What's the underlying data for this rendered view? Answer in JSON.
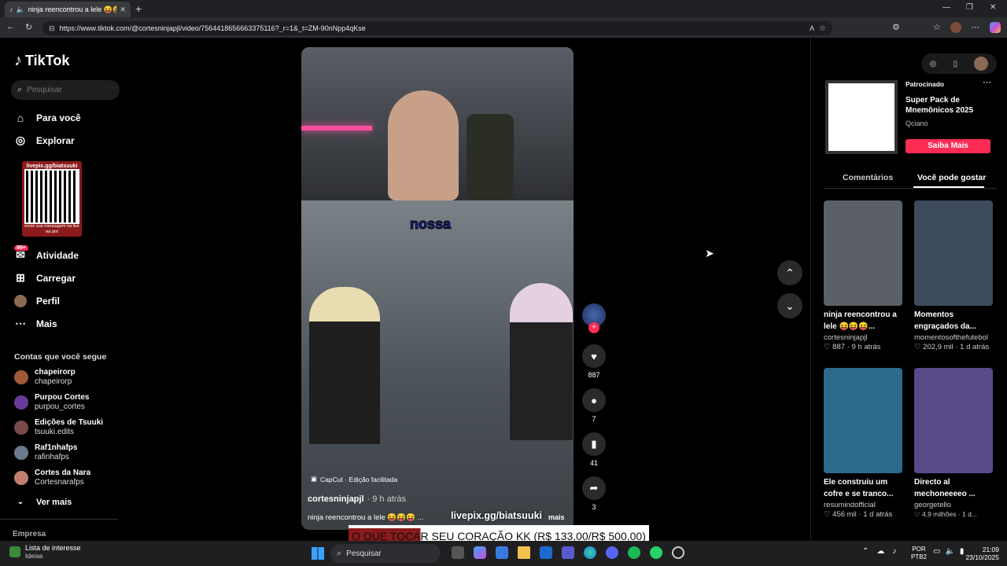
{
  "browser": {
    "tab_title": "ninja reencontrou a lele 😝😝",
    "new_tab": "+",
    "url": "https://www.tiktok.com/@cortesninjapjl/video/7564418656663375116?_r=1&_t=ZM-90nNpp4qKse",
    "window_controls": [
      "—",
      "❐",
      "✕"
    ]
  },
  "sidebar": {
    "logo": "TikTok",
    "search_placeholder": "Pesquisar",
    "nav": [
      {
        "label": "Para você",
        "icon": "⌂"
      },
      {
        "label": "Explorar",
        "icon": "◎"
      },
      {
        "label": "Atividade",
        "icon": "✉",
        "badge": "99+"
      },
      {
        "label": "Carregar",
        "icon": "⊞"
      },
      {
        "label": "Perfil",
        "icon": "●"
      },
      {
        "label": "Mais",
        "icon": "⋯"
      }
    ],
    "qr_overlay_top": "livepix.gg/biatsuuki",
    "qr_overlay_bottom": "envie sua mensagem na live via pix!",
    "following_title": "Contas que você segue",
    "following": [
      {
        "name": "chapeirorp",
        "user": "chapeirorp"
      },
      {
        "name": "Purpou Cortes",
        "user": "purpou_cortes"
      },
      {
        "name": "Edições de Tsuuki",
        "user": "tsuuki.edits"
      },
      {
        "name": "Raf1nhafps",
        "user": "rafinhafps"
      },
      {
        "name": "Cortes da Nara",
        "user": "Cortesnarafps"
      }
    ],
    "see_more": "Ver mais",
    "footer": "Empresa"
  },
  "video": {
    "caption_word": "nossa",
    "capcut": "CapCut · Edição facilitada",
    "author": "cortesninjapjl",
    "time": "· 9 h atrás",
    "description": "ninja reencontrou a lele 😝😝😝 ...",
    "more": "mais",
    "overlay_url": "livepix.gg/biatsuuki",
    "likes": "887",
    "comments": "7",
    "saves": "41",
    "shares": "3"
  },
  "banner": {
    "text": "O QUE TOCAR SEU CORAÇÃO KK (R$ 133,00/R$ 500,00)"
  },
  "right": {
    "sponsored": "Patrocinado",
    "ad_title": "Super Pack de Mnemônicos 2025",
    "ad_brand": "Qciano",
    "ad_button": "Saiba Mais",
    "tabs": [
      "Comentários",
      "Você pode gostar"
    ],
    "cards": [
      {
        "title": "ninja reencontrou a lele 😝😝😝...",
        "user": "cortesninjapjl",
        "likes": "887",
        "time": "9 h atrás",
        "color": "#5a6066"
      },
      {
        "title": "Momentos engraçados da...",
        "user": "momentosofthefutebol",
        "likes": "202,9 mil",
        "time": "1 d atrás",
        "color": "#3d4a5c"
      },
      {
        "title": "Ele construiu um cofre e se tranco...",
        "user": "resumindofficial",
        "likes": "456 mil",
        "time": "1 d atrás",
        "color": "#2d6a8a"
      },
      {
        "title": "Directo al mechoneeeeo ...",
        "user": "georgetello",
        "likes": "4,9 milhões",
        "time": "1 d...",
        "color": "#5a4a8a"
      }
    ]
  },
  "taskbar": {
    "widget_title": "Lista de interesse",
    "widget_sub": "Ideias",
    "search": "Pesquisar",
    "lang": "POR",
    "lang2": "PTB2",
    "time": "21:09",
    "date": "23/10/2025"
  }
}
